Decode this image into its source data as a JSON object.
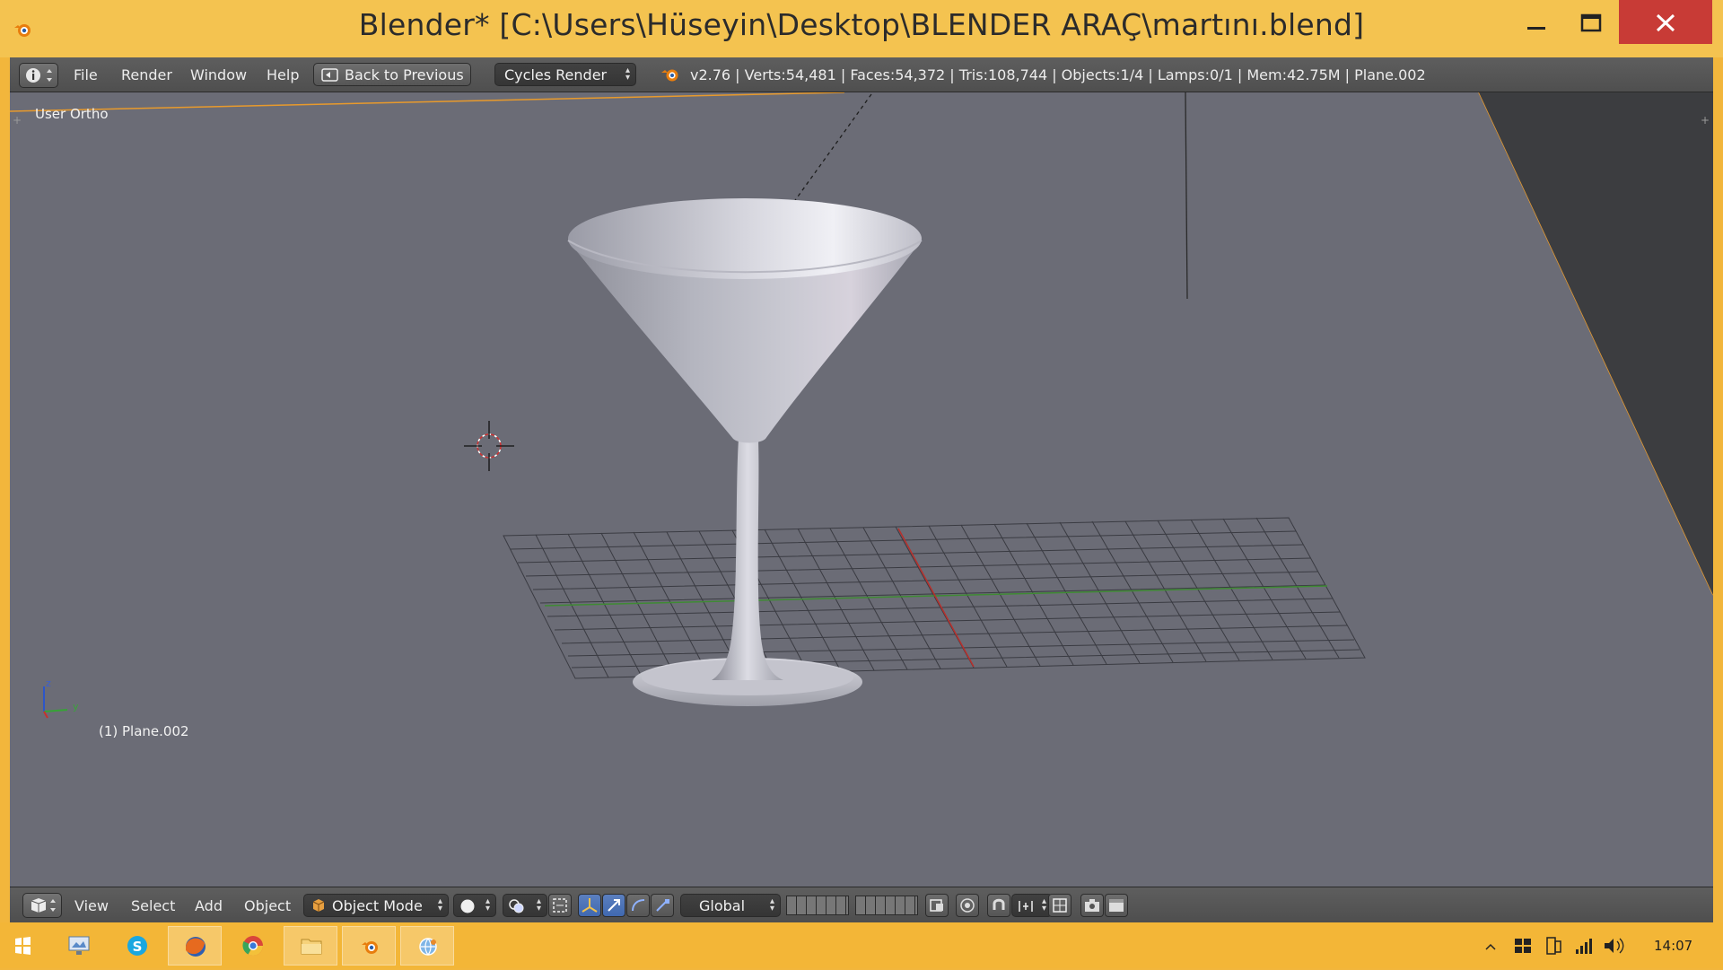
{
  "window": {
    "title": "Blender* [C:\\Users\\Hüseyin\\Desktop\\BLENDER ARAÇ\\martını.blend]",
    "title_bar_color": "#f4c350",
    "close_color": "#c83b36"
  },
  "info_header": {
    "menus": [
      "File",
      "Render",
      "Window",
      "Help"
    ],
    "back_button": "Back to Previous",
    "render_engine": "Cycles Render",
    "stats": "v2.76 | Verts:54,481 | Faces:54,372 | Tris:108,744 | Objects:1/4 | Lamps:0/1 | Mem:42.75M | Plane.002"
  },
  "viewport": {
    "view_label": "User Ortho",
    "object_label": "(1) Plane.002",
    "axis_z": "z",
    "axis_y": "y",
    "background": "#6b6c76",
    "selection_color": "#f0a030"
  },
  "view_header": {
    "menus": [
      "View",
      "Select",
      "Add",
      "Object"
    ],
    "mode": "Object Mode",
    "orientation": "Global"
  },
  "taskbar": {
    "apps": [
      "start-icon",
      "desktop-icon",
      "skype-icon",
      "firefox-icon",
      "chrome-icon",
      "explorer-icon",
      "blender-icon",
      "network-app-icon"
    ],
    "clock": "14:07"
  }
}
